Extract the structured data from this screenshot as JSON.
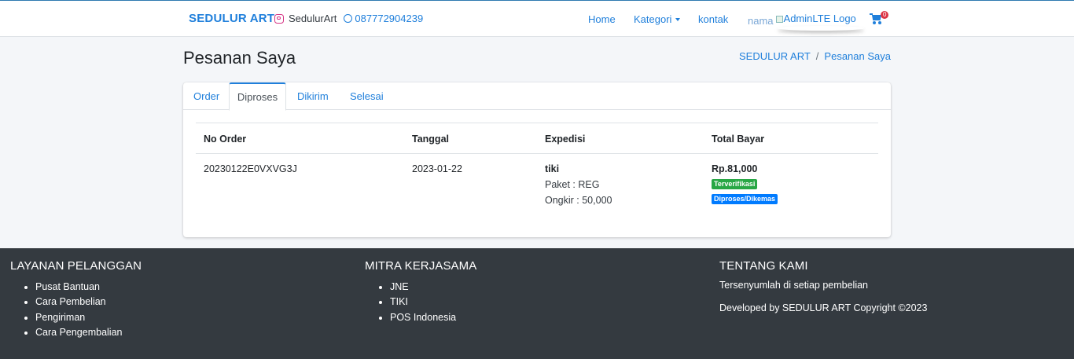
{
  "navbar": {
    "brand": "SEDULUR ART",
    "instagram": "SedulurArt",
    "whatsapp": "087772904239",
    "links": {
      "home": "Home",
      "kategori": "Kategori",
      "kontak": "kontak"
    },
    "user_name": "nama",
    "logo_alt": "AdminLTE Logo",
    "cart_count": "0"
  },
  "header": {
    "title": "Pesanan Saya",
    "breadcrumb": [
      "SEDULUR ART",
      "Pesanan Saya"
    ]
  },
  "tabs": [
    {
      "label": "Order",
      "active": false
    },
    {
      "label": "Diproses",
      "active": true
    },
    {
      "label": "Dikirim",
      "active": false
    },
    {
      "label": "Selesai",
      "active": false
    }
  ],
  "table": {
    "headers": [
      "No Order",
      "Tanggal",
      "Expedisi",
      "Total Bayar"
    ],
    "rows": [
      {
        "no_order": "20230122E0VXVG3J",
        "tanggal": "2023-01-22",
        "expedisi": "tiki",
        "paket": "Paket : REG",
        "ongkir": "Ongkir : 50,000",
        "total": "Rp.81,000",
        "badges": [
          "Terverifikasi",
          "Diproses/Dikemas"
        ]
      }
    ]
  },
  "footer": {
    "layanan": {
      "title": "LAYANAN PELANGGAN",
      "items": [
        "Pusat Bantuan",
        "Cara Pembelian",
        "Pengiriman",
        "Cara Pengembalian"
      ]
    },
    "mitra": {
      "title": "MITRA KERJASAMA",
      "items": [
        "JNE",
        "TIKI",
        "POS Indonesia"
      ]
    },
    "tentang": {
      "title": "TENTANG KAMI",
      "text": "Tersenyumlah di setiap pembelian",
      "copyright": "Developed by SEDULUR ART Copyright ©2023"
    }
  },
  "colors": {
    "accent": "#1f7fdb",
    "footer_bg": "#343a40",
    "badge_green": "#28a745",
    "badge_blue": "#007bff",
    "cart_badge": "#dc3545"
  }
}
